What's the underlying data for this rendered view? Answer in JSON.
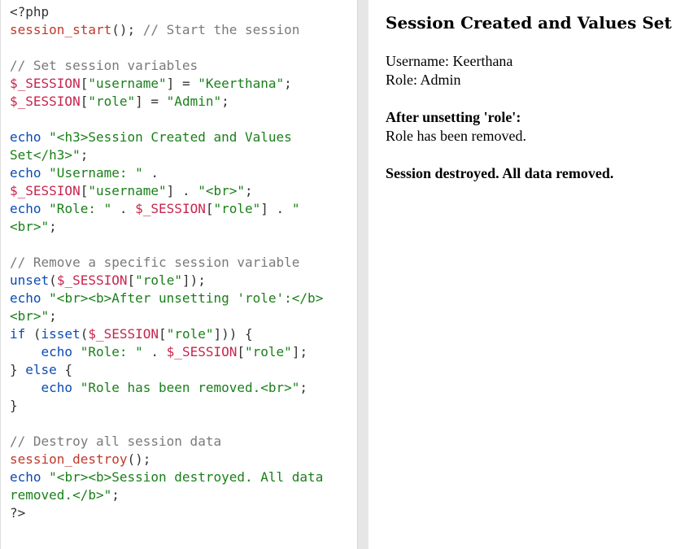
{
  "code_lines": [
    [
      {
        "t": "<?php",
        "c": "default"
      }
    ],
    [
      {
        "t": "session_start",
        "c": "func"
      },
      {
        "t": "(); ",
        "c": "punc"
      },
      {
        "t": "// Start the session",
        "c": "comment"
      }
    ],
    [],
    [
      {
        "t": "// Set session variables",
        "c": "comment"
      }
    ],
    [
      {
        "t": "$_SESSION",
        "c": "var"
      },
      {
        "t": "[",
        "c": "punc"
      },
      {
        "t": "\"username\"",
        "c": "str"
      },
      {
        "t": "] = ",
        "c": "punc"
      },
      {
        "t": "\"Keerthana\"",
        "c": "str"
      },
      {
        "t": ";",
        "c": "punc"
      }
    ],
    [
      {
        "t": "$_SESSION",
        "c": "var"
      },
      {
        "t": "[",
        "c": "punc"
      },
      {
        "t": "\"role\"",
        "c": "str"
      },
      {
        "t": "] = ",
        "c": "punc"
      },
      {
        "t": "\"Admin\"",
        "c": "str"
      },
      {
        "t": ";",
        "c": "punc"
      }
    ],
    [],
    [
      {
        "t": "echo",
        "c": "keyword"
      },
      {
        "t": " ",
        "c": "punc"
      },
      {
        "t": "\"<h3>Session Created and Values",
        "c": "str"
      }
    ],
    [
      {
        "t": "Set</h3>\"",
        "c": "str"
      },
      {
        "t": ";",
        "c": "punc"
      }
    ],
    [
      {
        "t": "echo",
        "c": "keyword"
      },
      {
        "t": " ",
        "c": "punc"
      },
      {
        "t": "\"Username: \"",
        "c": "str"
      },
      {
        "t": " .",
        "c": "punc"
      }
    ],
    [
      {
        "t": "$_SESSION",
        "c": "var"
      },
      {
        "t": "[",
        "c": "punc"
      },
      {
        "t": "\"username\"",
        "c": "str"
      },
      {
        "t": "] . ",
        "c": "punc"
      },
      {
        "t": "\"<br>\"",
        "c": "str"
      },
      {
        "t": ";",
        "c": "punc"
      }
    ],
    [
      {
        "t": "echo",
        "c": "keyword"
      },
      {
        "t": " ",
        "c": "punc"
      },
      {
        "t": "\"Role: \"",
        "c": "str"
      },
      {
        "t": " . ",
        "c": "punc"
      },
      {
        "t": "$_SESSION",
        "c": "var"
      },
      {
        "t": "[",
        "c": "punc"
      },
      {
        "t": "\"role\"",
        "c": "str"
      },
      {
        "t": "] . ",
        "c": "punc"
      },
      {
        "t": "\"",
        "c": "str"
      }
    ],
    [
      {
        "t": "<br>\"",
        "c": "str"
      },
      {
        "t": ";",
        "c": "punc"
      }
    ],
    [],
    [
      {
        "t": "// Remove a specific session variable",
        "c": "comment"
      }
    ],
    [
      {
        "t": "unset",
        "c": "keyword"
      },
      {
        "t": "(",
        "c": "punc"
      },
      {
        "t": "$_SESSION",
        "c": "var"
      },
      {
        "t": "[",
        "c": "punc"
      },
      {
        "t": "\"role\"",
        "c": "str"
      },
      {
        "t": "]);",
        "c": "punc"
      }
    ],
    [
      {
        "t": "echo",
        "c": "keyword"
      },
      {
        "t": " ",
        "c": "punc"
      },
      {
        "t": "\"<br><b>After unsetting 'role':</b>",
        "c": "str"
      }
    ],
    [
      {
        "t": "<br>\"",
        "c": "str"
      },
      {
        "t": ";",
        "c": "punc"
      }
    ],
    [
      {
        "t": "if",
        "c": "keyword"
      },
      {
        "t": " (",
        "c": "punc"
      },
      {
        "t": "isset",
        "c": "keyword"
      },
      {
        "t": "(",
        "c": "punc"
      },
      {
        "t": "$_SESSION",
        "c": "var"
      },
      {
        "t": "[",
        "c": "punc"
      },
      {
        "t": "\"role\"",
        "c": "str"
      },
      {
        "t": "])) {",
        "c": "punc"
      }
    ],
    [
      {
        "t": "    ",
        "c": "punc"
      },
      {
        "t": "echo",
        "c": "keyword"
      },
      {
        "t": " ",
        "c": "punc"
      },
      {
        "t": "\"Role: \"",
        "c": "str"
      },
      {
        "t": " . ",
        "c": "punc"
      },
      {
        "t": "$_SESSION",
        "c": "var"
      },
      {
        "t": "[",
        "c": "punc"
      },
      {
        "t": "\"role\"",
        "c": "str"
      },
      {
        "t": "];",
        "c": "punc"
      }
    ],
    [
      {
        "t": "} ",
        "c": "punc"
      },
      {
        "t": "else",
        "c": "keyword"
      },
      {
        "t": " {",
        "c": "punc"
      }
    ],
    [
      {
        "t": "    ",
        "c": "punc"
      },
      {
        "t": "echo",
        "c": "keyword"
      },
      {
        "t": " ",
        "c": "punc"
      },
      {
        "t": "\"Role has been removed.<br>\"",
        "c": "str"
      },
      {
        "t": ";",
        "c": "punc"
      }
    ],
    [
      {
        "t": "}",
        "c": "punc"
      }
    ],
    [],
    [
      {
        "t": "// Destroy all session data",
        "c": "comment"
      }
    ],
    [
      {
        "t": "session_destroy",
        "c": "func"
      },
      {
        "t": "();",
        "c": "punc"
      }
    ],
    [
      {
        "t": "echo",
        "c": "keyword"
      },
      {
        "t": " ",
        "c": "punc"
      },
      {
        "t": "\"<br><b>Session destroyed. All data",
        "c": "str"
      }
    ],
    [
      {
        "t": "removed.</b>\"",
        "c": "str"
      },
      {
        "t": ";",
        "c": "punc"
      }
    ],
    [
      {
        "t": "?>",
        "c": "default"
      }
    ]
  ],
  "output": {
    "heading": "Session Created and Values Set",
    "username_line": "Username: Keerthana",
    "role_line": "Role: Admin",
    "after_unset_label": "After unsetting 'role':",
    "role_removed_line": "Role has been removed.",
    "destroyed_line": "Session destroyed. All data removed."
  },
  "colors": {
    "function": "#c0392b",
    "variable": "#c7254e",
    "string": "#1a7f1a",
    "comment": "#7a7a7a",
    "keyword": "#0b4bb3",
    "default": "#333333",
    "divider": "#e6e6e6"
  }
}
